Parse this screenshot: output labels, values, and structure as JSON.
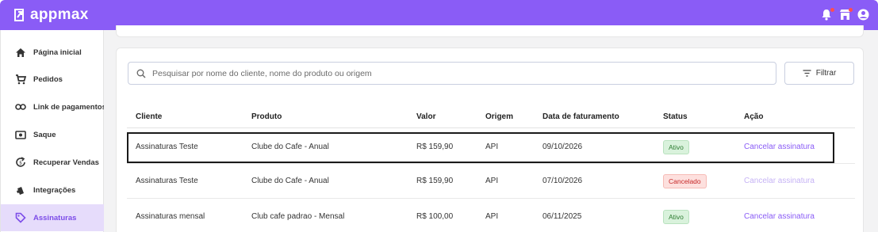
{
  "brand": {
    "name": "appmax",
    "accent": "#8a5cf6",
    "active_bg": "#e6dcfb"
  },
  "topbar_icons": [
    "bell-icon",
    "store-icon",
    "user-icon"
  ],
  "sidebar": {
    "items": [
      {
        "label": "Página inicial",
        "icon": "home-icon"
      },
      {
        "label": "Pedidos",
        "icon": "cart-icon"
      },
      {
        "label": "Link de pagamentos",
        "icon": "link-icon"
      },
      {
        "label": "Saque",
        "icon": "cash-icon"
      },
      {
        "label": "Recuperar Vendas",
        "icon": "recover-icon"
      },
      {
        "label": "Integrações",
        "icon": "integrations-icon"
      },
      {
        "label": "Assinaturas",
        "icon": "tag-icon",
        "active": true
      }
    ]
  },
  "search": {
    "placeholder": "Pesquisar por nome do cliente, nome do produto ou origem"
  },
  "filter": {
    "label": "Filtrar"
  },
  "table": {
    "columns": [
      "Cliente",
      "Produto",
      "Valor",
      "Origem",
      "Data de faturamento",
      "Status",
      "Ação"
    ],
    "rows": [
      {
        "cliente": "Assinaturas Teste",
        "produto": "Clube do Cafe - Anual",
        "valor": "R$ 159,90",
        "origem": "API",
        "data": "09/10/2026",
        "status": "Ativo",
        "acao": "Cancelar assinatura"
      },
      {
        "cliente": "Assinaturas Teste",
        "produto": "Clube do Cafe - Anual",
        "valor": "R$ 159,90",
        "origem": "API",
        "data": "07/10/2026",
        "status": "Cancelado",
        "acao": "Cancelar assinatura"
      },
      {
        "cliente": "Assinaturas mensal",
        "produto": "Club cafe padrao - Mensal",
        "valor": "R$ 100,00",
        "origem": "API",
        "data": "06/11/2025",
        "status": "Ativo",
        "acao": "Cancelar assinatura"
      }
    ]
  }
}
